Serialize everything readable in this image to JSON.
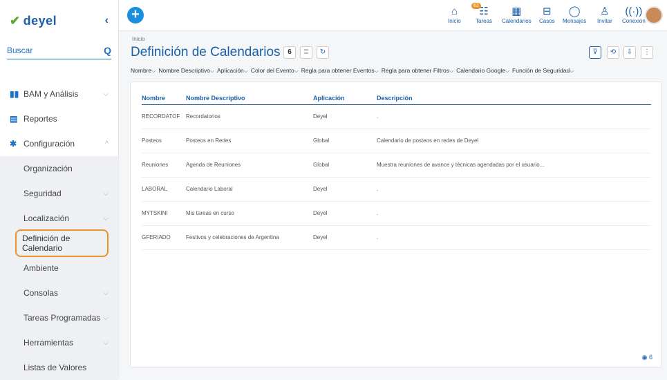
{
  "app": {
    "logo": "deyel",
    "collapse": "‹"
  },
  "search": {
    "label": "Buscar",
    "icon": "search-icon"
  },
  "menu": [
    {
      "label": "BAM y Análisis",
      "icon": "chart-icon",
      "chev": "⌵"
    },
    {
      "label": "Reportes",
      "icon": "report-icon",
      "chev": ""
    },
    {
      "label": "Configuración",
      "icon": "gear-icon",
      "chev": "^"
    }
  ],
  "submenu": [
    {
      "label": "Organización",
      "chev": ""
    },
    {
      "label": "Seguridad",
      "chev": "⌵"
    },
    {
      "label": "Localización",
      "chev": "⌵"
    },
    {
      "label": "Definición de Calendario",
      "chev": ""
    },
    {
      "label": "Ambiente",
      "chev": ""
    },
    {
      "label": "Consolas",
      "chev": "⌵"
    },
    {
      "label": "Tareas Programadas",
      "chev": "⌵"
    },
    {
      "label": "Herramientas",
      "chev": "⌵"
    },
    {
      "label": "Listas de Valores",
      "chev": ""
    }
  ],
  "topbar": {
    "items": [
      {
        "label": "Inicio",
        "glyph": "⌂"
      },
      {
        "label": "Tareas",
        "glyph": "☷",
        "badge": "62"
      },
      {
        "label": "Calendarios",
        "glyph": "▦"
      },
      {
        "label": "Casos",
        "glyph": "⊟"
      },
      {
        "label": "Mensajes",
        "glyph": "◯"
      },
      {
        "label": "Invitar",
        "glyph": "♙"
      },
      {
        "label": "Conexión",
        "glyph": "((·))"
      }
    ]
  },
  "page": {
    "breadcrumb": "Inicio",
    "title": "Definición de Calendarios",
    "count": "6",
    "footer_count": "6"
  },
  "filters": [
    "Nombre",
    "Nombre Descriptivo",
    "Aplicación",
    "Color del Evento",
    "Regla para obtener Eventos",
    "Regla para obtener Filtros",
    "Calendario Google",
    "Función de Seguridad"
  ],
  "table": {
    "headers": [
      "Nombre",
      "Nombre Descriptivo",
      "Aplicación",
      "Descripción"
    ],
    "rows": [
      [
        "RECORDATOF",
        "Recordatorios",
        "Deyel",
        "."
      ],
      [
        "Posteos",
        "Posteos en Redes",
        "Global",
        "Calendario de posteos en redes de Deyel"
      ],
      [
        "Reuniones",
        "Agenda de Reuniones",
        "Global",
        "Muestra reuniones de avance y técnicas agendadas por el usuario..."
      ],
      [
        "LABORAL",
        "Calendario Laboral",
        "Deyel",
        "."
      ],
      [
        "MYTSKINI",
        "Mis tareas en curso",
        "Deyel",
        "."
      ],
      [
        "GFERIADO",
        "Festivos y celebraciones de Argentina",
        "Deyel",
        "."
      ]
    ]
  }
}
